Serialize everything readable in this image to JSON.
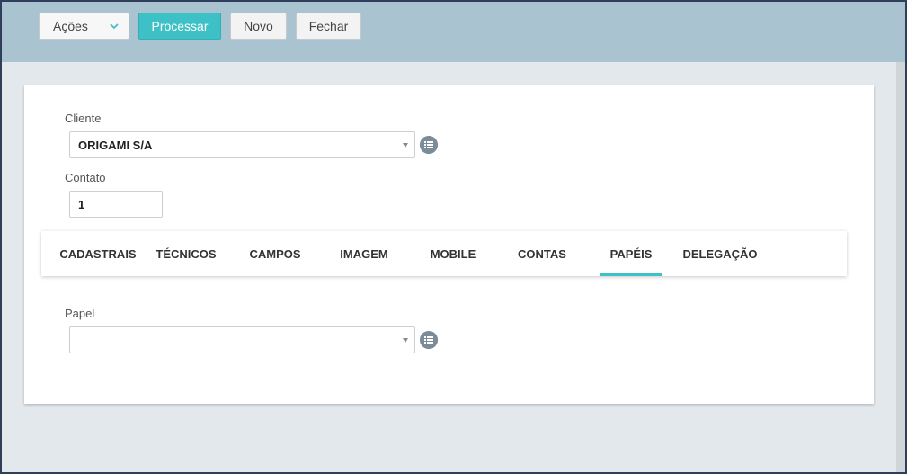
{
  "toolbar": {
    "acoes_label": "Ações",
    "processar_label": "Processar",
    "novo_label": "Novo",
    "fechar_label": "Fechar"
  },
  "form": {
    "cliente_label": "Cliente",
    "cliente_value": "ORIGAMI S/A",
    "contato_label": "Contato",
    "contato_value": "1",
    "papel_label": "Papel",
    "papel_value": ""
  },
  "tabs": [
    {
      "label": "CADASTRAIS",
      "active": false
    },
    {
      "label": "TÉCNICOS",
      "active": false
    },
    {
      "label": "CAMPOS",
      "active": false
    },
    {
      "label": "IMAGEM",
      "active": false
    },
    {
      "label": "MOBILE",
      "active": false
    },
    {
      "label": "CONTAS",
      "active": false
    },
    {
      "label": "PAPÉIS",
      "active": true
    },
    {
      "label": "DELEGAÇÃO",
      "active": false
    }
  ],
  "colors": {
    "accent": "#3ec1c6",
    "toolbar_bg": "#a9c3d0",
    "page_bg": "#e3e8ec"
  },
  "icons": {
    "acoes_dropdown": "chevron-down-icon",
    "cliente_lookup": "list-icon",
    "papel_lookup": "list-icon"
  }
}
